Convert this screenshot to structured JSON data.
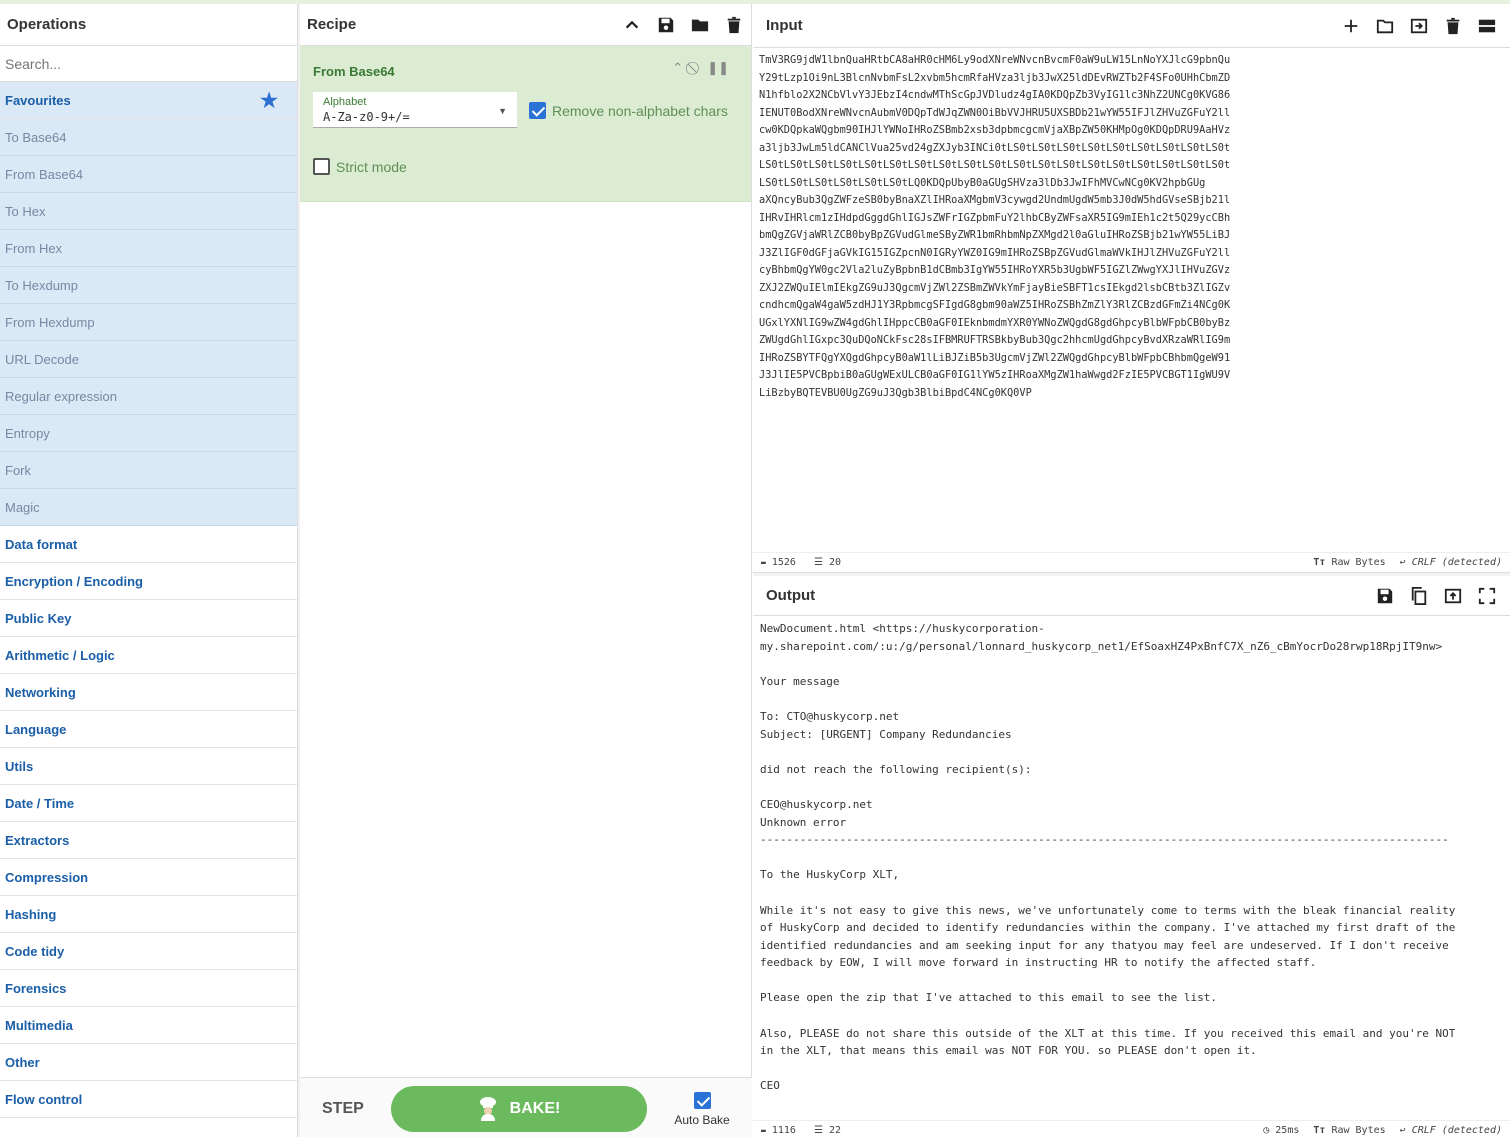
{
  "operations": {
    "title": "Operations",
    "search_placeholder": "Search...",
    "favourites_label": "Favourites",
    "favourite_ops": [
      "To Base64",
      "From Base64",
      "To Hex",
      "From Hex",
      "To Hexdump",
      "From Hexdump",
      "URL Decode",
      "Regular expression",
      "Entropy",
      "Fork",
      "Magic"
    ],
    "categories": [
      "Data format",
      "Encryption / Encoding",
      "Public Key",
      "Arithmetic / Logic",
      "Networking",
      "Language",
      "Utils",
      "Date / Time",
      "Extractors",
      "Compression",
      "Hashing",
      "Code tidy",
      "Forensics",
      "Multimedia",
      "Other",
      "Flow control"
    ]
  },
  "recipe": {
    "title": "Recipe",
    "ingredient": {
      "name": "From Base64",
      "alphabet_label": "Alphabet",
      "alphabet_value": "A-Za-z0-9+/=",
      "remove_nonalpha_label": "Remove non-alphabet chars",
      "remove_nonalpha_checked": true,
      "strict_label": "Strict mode",
      "strict_checked": false
    },
    "step_label": "STEP",
    "bake_label": "BAKE!",
    "auto_bake_label": "Auto Bake",
    "auto_bake_checked": true
  },
  "input": {
    "title": "Input",
    "text": "TmV3RG9jdW1lbnQuaHRtbCA8aHR0cHM6Ly9odXNreWNvcnBvcmF0aW9uLW15LnNoYXJlcG9pbnQu\nY29tLzp1Oi9nL3BlcnNvbmFsL2xvbm5hcmRfaHVza3ljb3JwX25ldDEvRWZTb2F4SFo0UHhCbmZD\nN1hfblo2X2NCbVlvY3JEbzI4cndwMThScGpJVDludz4gIA0KDQpZb3VyIG1lc3NhZ2UNCg0KVG86\nIENUT0BodXNreWNvcnAubmV0DQpTdWJqZWN0OiBbVVJHRU5UXSBDb21wYW55IFJlZHVuZGFuY2ll\ncw0KDQpkaWQgbm90IHJlYWNoIHRoZSBmb2xsb3dpbmcgcmVjaXBpZW50KHMpOg0KDQpDRU9AaHVz\na3ljb3JwLm5ldCANClVua25vd24gZXJyb3INCi0tLS0tLS0tLS0tLS0tLS0tLS0tLS0tLS0tLS0t\nLS0tLS0tLS0tLS0tLS0tLS0tLS0tLS0tLS0tLS0tLS0tLS0tLS0tLS0tLS0tLS0tLS0tLS0tLS0t\nLS0tLS0tLS0tLS0tLS0tLS0tLQ0KDQpUbyB0aGUgSHVza3lDb3JwIFhMVCwNCg0KV2hpbGUg\naXQncyBub3QgZWFzeSB0byBnaXZlIHRoaXMgbmV3cywgd2UndmUgdW5mb3J0dW5hdGVseSBjb21l\nIHRvIHRlcm1zIHdpdGggdGhlIGJsZWFrIGZpbmFuY2lhbCByZWFsaXR5IG9mIEh1c2t5Q29ycCBh\nbmQgZGVjaWRlZCB0byBpZGVudGlmeSByZWR1bmRhbmNpZXMgd2l0aGluIHRoZSBjb21wYW55LiBJ\nJ3ZlIGF0dGFjaGVkIG15IGZpcnN0IGRyYWZ0IG9mIHRoZSBpZGVudGlmaWVkIHJlZHVuZGFuY2ll\ncyBhbmQgYW0gc2Vla2luZyBpbnB1dCBmb3IgYW55IHRoYXR5b3UgbWF5IGZlZWwgYXJlIHVuZGVz\nZXJ2ZWQuIElmIEkgZG9uJ3QgcmVjZWl2ZSBmZWVkYmFjayBieSBFT1csIEkgd2lsbCBtb3ZlIGZv\ncndhcmQgaW4gaW5zdHJ1Y3RpbmcgSFIgdG8gbm90aWZ5IHRoZSBhZmZlY3RlZCBzdGFmZi4NCg0K\nUGxlYXNlIG9wZW4gdGhlIHppcCB0aGF0IEknbmdmYXR0YWNoZWQgdG8gdGhpcyBlbWFpbCB0byBz\nZWUgdGhlIGxpc3QuDQoNCkFsc28sIFBMRUFTRSBkbyBub3Qgc2hhcmUgdGhpcyBvdXRzaWRlIG9m\nIHRoZSBYTFQgYXQgdGhpcyB0aW1lLiBJZiB5b3UgcmVjZWl2ZWQgdGhpcyBlbWFpbCBhbmQgeW91\nJ3JlIE5PVCBpbiB0aGUgWExULCB0aGF0IG1lYW5zIHRoaXMgZW1haWwgd2FzIE5PVCBGT1IgWU9V\nLiBzbyBQTEVBU0UgZG9uJ3Qgb3BlbiBpdC4NCg0KQ0VP",
    "char_count": "1526",
    "line_count": "20",
    "mode": "Raw Bytes",
    "eol": "CRLF (detected)"
  },
  "output": {
    "title": "Output",
    "text": "NewDocument.html <https://huskycorporation-\nmy.sharepoint.com/:u:/g/personal/lonnard_huskycorp_net1/EfSoaxHZ4PxBnfC7X_nZ6_cBmYocrDo28rwp18RpjIT9nw>\n\nYour message\n\nTo: CTO@huskycorp.net\nSubject: [URGENT] Company Redundancies\n\ndid not reach the following recipient(s):\n\nCEO@huskycorp.net\nUnknown error\n--------------------------------------------------------------------------------------------------------\n\nTo the HuskyCorp XLT,\n\nWhile it's not easy to give this news, we've unfortunately come to terms with the bleak financial reality\nof HuskyCorp and decided to identify redundancies within the company. I've attached my first draft of the\nidentified redundancies and am seeking input for any thatyou may feel are undeserved. If I don't receive\nfeedback by EOW, I will move forward in instructing HR to notify the affected staff.\n\nPlease open the zip that I've attached to this email to see the list.\n\nAlso, PLEASE do not share this outside of the XLT at this time. If you received this email and you're NOT\nin the XLT, that means this email was NOT FOR YOU. so PLEASE don't open it.\n\nCEO",
    "char_count": "1116",
    "line_count": "22",
    "time": "25ms",
    "mode": "Raw Bytes",
    "eol": "CRLF (detected)"
  },
  "icons": {
    "rec": "rec-icon",
    "lines": "lines-icon"
  }
}
